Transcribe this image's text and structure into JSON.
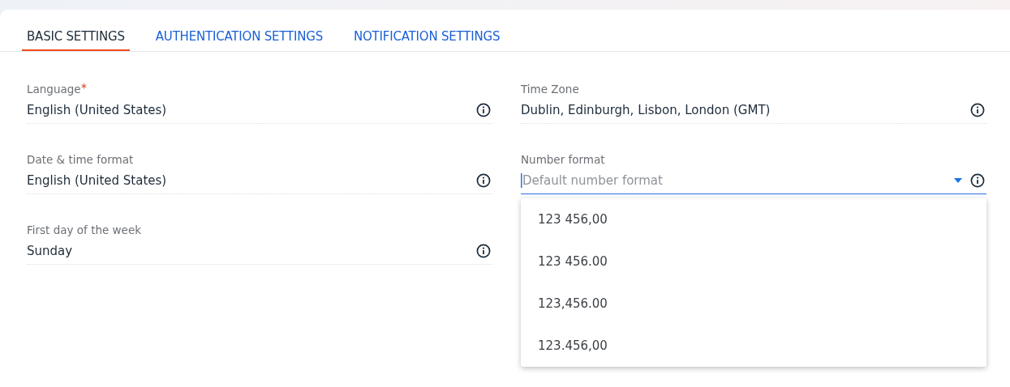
{
  "tabs": [
    {
      "label": "BASIC SETTINGS",
      "selected": true
    },
    {
      "label": "AUTHENTICATION SETTINGS",
      "selected": false
    },
    {
      "label": "NOTIFICATION SETTINGS",
      "selected": false
    }
  ],
  "fields": [
    {
      "label": "Language",
      "kind": "text",
      "required_mark": "*",
      "focused": false,
      "value": "English (United States)"
    },
    {
      "label": "Time Zone",
      "kind": "text",
      "focused": false,
      "value": "Dublin, Edinburgh, Lisbon, London (GMT)"
    },
    {
      "label": "Date & time format",
      "kind": "text",
      "focused": false,
      "value": "English (United States)"
    },
    {
      "label": "Number format",
      "kind": "select",
      "focused": true,
      "placeholder": "Default number format",
      "expanded": true,
      "options": [
        "123 456,00",
        "123 456.00",
        "123,456.00",
        "123.456,00"
      ]
    },
    {
      "label": "First day of the week",
      "kind": "text",
      "focused": false,
      "value": "Sunday"
    }
  ]
}
